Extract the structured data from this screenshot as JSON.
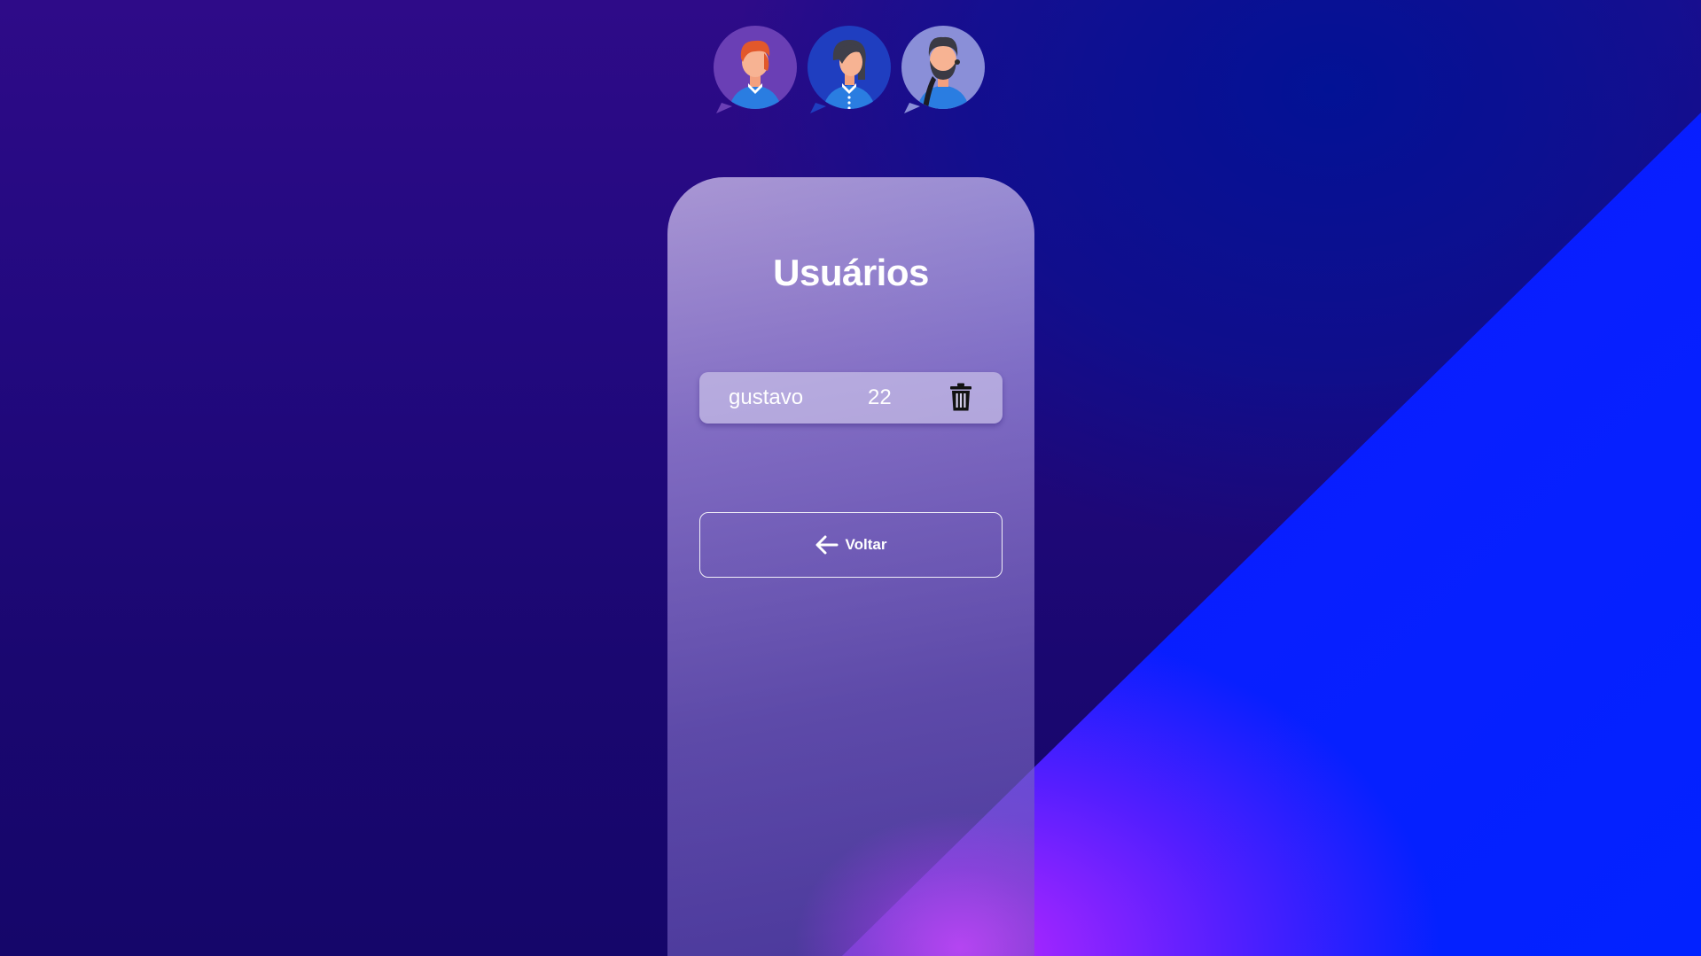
{
  "avatars": [
    {
      "name": "avatar-redhead-man",
      "icon": "user-avatar-icon"
    },
    {
      "name": "avatar-woman",
      "icon": "user-avatar-icon"
    },
    {
      "name": "avatar-bearded-man",
      "icon": "user-avatar-icon"
    }
  ],
  "page": {
    "title": "Usuários"
  },
  "users": [
    {
      "name": "gustavo",
      "age": "22",
      "action_icon": "trash-icon"
    }
  ],
  "back_button": {
    "label": "Voltar",
    "icon": "arrow-left-icon"
  },
  "colors": {
    "background_purple": "#22097f",
    "background_blue": "#0222ff",
    "accent_violet": "#b43cff",
    "text": "#ffffff"
  }
}
